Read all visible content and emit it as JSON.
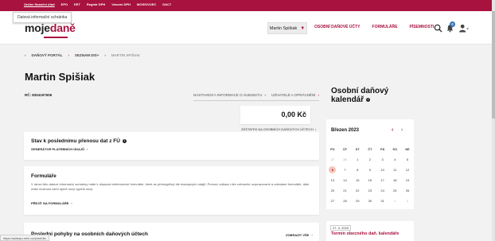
{
  "topbar": {
    "links": [
      "Online finanční úřad",
      "EPO",
      "EET",
      "Registr DPH",
      "Vracení DPH",
      "MOSS/VOEC",
      "DAC7"
    ],
    "tooltip": "Datová informační schránka",
    "accent_color": "#a8123f"
  },
  "header": {
    "logo_part1": "moje",
    "logo_part2": "daně",
    "user_select": "Martin Spišiak",
    "nav": [
      "OSOBNÍ DAŇOVÉ ÚČTY",
      "FORMULÁŘE",
      "PÍSEMNOSTI"
    ],
    "notification_count": "0",
    "icons": [
      "search-icon",
      "bell-icon",
      "user-icon"
    ]
  },
  "breadcrumbs": {
    "items": [
      "DAŇOVÝ PORTÁL",
      "SEZNAM DIS+",
      "MARTIN SPIŠIAK"
    ]
  },
  "page": {
    "title": "Martin Spišiak",
    "rc": "RČ: 8304197506",
    "link_settings": "NASTAVENÍ A INFORMACE O SUBJEKTU",
    "link_users": "UŽIVATELÉ A OPRÁVNĚNÍ"
  },
  "balance": {
    "amount": "0,00 Kč",
    "label": "ZŮSTATEK NA OSOBNÍCH DAŇOVÝCH ÚČTECH"
  },
  "cards": {
    "transfer_title": "Stav k poslednímu přenosu dat z FÚ",
    "transfer_link": "GENERÁTOR PLATEBNÍCH ÚDAJŮ",
    "forms_title": "Formuláře",
    "forms_text": "V rámci této datové informační schránky máte k dispozici elektronické formuláře, které se předvyplňují dle dostupných údajů. Pomocí odkazu níže zobrazíte rozpracované a odeslané formuláře, dále máte možnost začít úplně nový vyplnit nový.",
    "forms_link": "PŘEJÍT NA FORMULÁŘE",
    "movements_title": "Poslední pohyby na osobních daňových účtech",
    "movements_link": "ZOBRAZIT VŠE"
  },
  "calendar": {
    "title": "Osobní daňový kalendář",
    "month": "Březen 2023",
    "weekdays": [
      "PO",
      "ÚT",
      "ST",
      "ČT",
      "PÁ",
      "SO",
      "NE"
    ],
    "weeks": [
      [
        "27",
        "28",
        "1",
        "2",
        "3",
        "4",
        "5"
      ],
      [
        "6",
        "7",
        "8",
        "9",
        "10",
        "11",
        "12"
      ],
      [
        "13",
        "14",
        "15",
        "16",
        "17",
        "18",
        "19"
      ],
      [
        "20",
        "21",
        "22",
        "23",
        "24",
        "25",
        "26"
      ],
      [
        "27",
        "28",
        "29",
        "30",
        "31",
        "1",
        "2"
      ]
    ],
    "today": "6",
    "event_date": "27. 3. 2023",
    "event_title": "Termín obecného daň. kalendáře"
  },
  "status": {
    "url": "https://adisspr.mfcr.cz/pmd/dis"
  }
}
